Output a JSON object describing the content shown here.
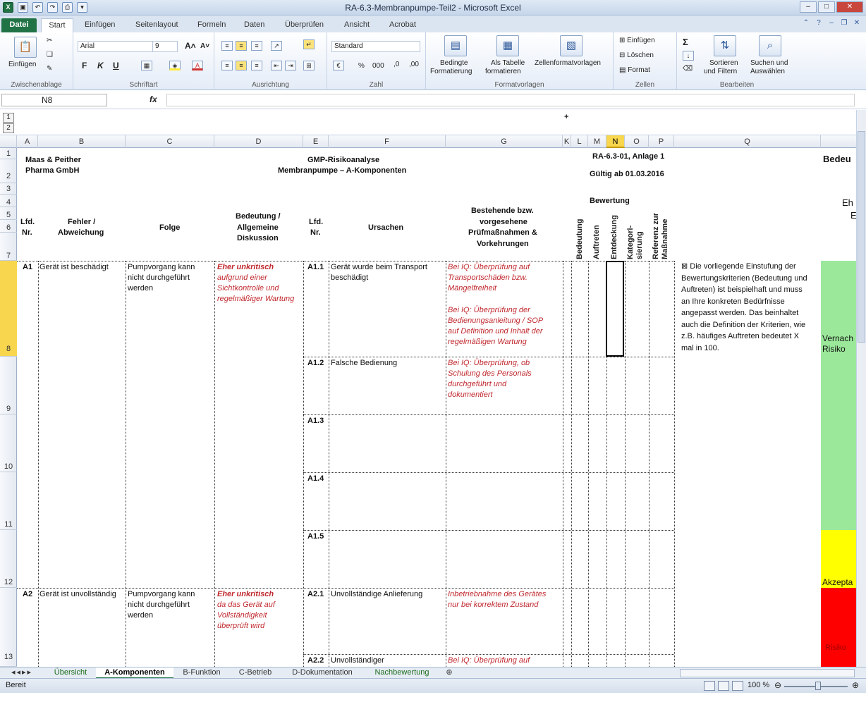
{
  "window": {
    "title": "RA-6.3-Membranpumpe-Teil2 - Microsoft Excel",
    "app_icon": "excel-icon"
  },
  "ribbon_tabs": [
    "Datei",
    "Start",
    "Einfügen",
    "Seitenlayout",
    "Formeln",
    "Daten",
    "Überprüfen",
    "Ansicht",
    "Acrobat"
  ],
  "ribbon": {
    "clipboard": {
      "label": "Zwischenablage",
      "paste": "Einfügen"
    },
    "font": {
      "label": "Schriftart",
      "name": "Arial",
      "size": "9",
      "bold": "F",
      "italic": "K",
      "underline": "U"
    },
    "alignment": {
      "label": "Ausrichtung"
    },
    "number": {
      "label": "Zahl",
      "format": "Standard",
      "percent": "%",
      "thousands": "000"
    },
    "styles": {
      "label": "Formatvorlagen",
      "conditional": "Bedingte",
      "conditional2": "Formatierung",
      "table": "Als Tabelle",
      "table2": "formatieren",
      "cell": "Zellenformatvorlagen"
    },
    "cells": {
      "label": "Zellen",
      "insert": "Einfügen",
      "delete": "Löschen",
      "format": "Format"
    },
    "editing": {
      "label": "Bearbeiten",
      "sort": "Sortieren",
      "sort2": "und Filtern",
      "find": "Suchen und",
      "find2": "Auswählen"
    }
  },
  "formula_bar": {
    "name_box": "N8",
    "fx": "fx",
    "content": ""
  },
  "outline_levels": [
    "1",
    "2"
  ],
  "columns": [
    "A",
    "B",
    "C",
    "D",
    "E",
    "F",
    "G",
    "K",
    "L",
    "M",
    "N",
    "O",
    "P",
    "Q"
  ],
  "selected_column": "N",
  "rows": [
    "1",
    "2",
    "3",
    "4",
    "5",
    "6",
    "7",
    "8",
    "9",
    "10",
    "11",
    "12",
    "13"
  ],
  "selected_row": "8",
  "header": {
    "company1": "Maas & Peither",
    "company2": "Pharma GmbH",
    "title1": "GMP-Risikoanalyse",
    "title2": "Membranpumpe – A-Komponenten",
    "doc_ref": "RA-6.3-01, Anlage 1",
    "valid": "Gültig ab 01.03.2016",
    "right_head": "Bedeu",
    "right_eh": "Eh",
    "right_e": "E"
  },
  "table_headers": {
    "lfd1a": "Lfd.",
    "lfd1b": "Nr.",
    "fehler1": "Fehler /",
    "fehler2": "Abweichung",
    "folge": "Folge",
    "bedeutung1": "Bedeutung /",
    "bedeutung2": "Allgemeine",
    "bedeutung3": "Diskussion",
    "lfd2a": "Lfd.",
    "lfd2b": "Nr.",
    "ursachen": "Ursachen",
    "massn1": "Bestehende bzw.",
    "massn2": "vorgesehene",
    "massn3": "Prüfmaßnahmen &",
    "massn4": "Vorkehrungen",
    "bewertung": "Bewertung",
    "v_bedeutung": "Bedeutung",
    "v_auftreten": "Auftreten",
    "v_entdeckung": "Entdeckung",
    "v_kategori1": "Kategori-",
    "v_kategori2": "sierung",
    "v_referenz1": "Referenz zur",
    "v_referenz2": "Maßnahme"
  },
  "rows_data": {
    "r8": {
      "id": "A1",
      "fehler": "Gerät ist beschädigt",
      "folge": [
        "Pumpvorgang kann",
        "nicht durchgeführt",
        "werden"
      ],
      "bed_bold": "Eher unkritisch",
      "bed": [
        "aufgrund einer",
        "Sichtkontrolle und",
        "regelmäßiger Wartung"
      ],
      "sub": "A1.1",
      "ursache": [
        "Gerät wurde beim Transport",
        "beschädigt"
      ],
      "massn": [
        "Bei IQ: Überprüfung auf",
        "Transportschäden bzw.",
        "Mängelfreiheit",
        "",
        "Bei IQ: Überprüfung der",
        "Bedienungsanleitung / SOP",
        "auf Definition und Inhalt der",
        "regelmäßigen Wartung"
      ]
    },
    "r9": {
      "sub": "A1.2",
      "ursache": "Falsche Bedienung",
      "massn": [
        "Bei IQ: Überprüfung, ob",
        "Schulung des Personals",
        "durchgeführt und",
        "dokumentiert"
      ]
    },
    "r10": {
      "sub": "A1.3"
    },
    "r11": {
      "sub": "A1.4"
    },
    "r12": {
      "sub": "A1.5"
    },
    "r13": {
      "id": "A2",
      "fehler": "Gerät ist unvollständig",
      "folge": [
        "Pumpvorgang kann",
        "nicht durchgeführt",
        "werden"
      ],
      "bed_bold": "Eher unkritisch",
      "bed": [
        "da das Gerät auf",
        "Vollständigkeit",
        "überprüft wird"
      ],
      "sub": "A2.1",
      "ursache": "Unvollständige Anlieferung",
      "massn": [
        "Inbetriebnahme des Gerätes",
        "nur bei korrektem Zustand"
      ]
    },
    "r14": {
      "sub": "A2.2",
      "ursache": "Unvollständiger",
      "massn": "Bei IQ: Überprüfung auf"
    }
  },
  "note": [
    "⊠ Die vorliegende Einstufung der",
    "Bewertungskriterien (Bedeutung und",
    "Auftreten) ist beispielhaft und muss",
    "an Ihre konkreten Bedürfnisse",
    "angepasst werden. Das beinhaltet",
    "auch die Definition der Kriterien, wie",
    "z.B. häufiges Auftreten bedeutet X",
    "mal in 100."
  ],
  "legend": {
    "green_label1": "Vernach",
    "green_label2": "Risiko",
    "yellow_label": "Akzepta",
    "red_label": "Risiko",
    "colors": {
      "green": "#9be89b",
      "yellow": "#ffff00",
      "red": "#ff0000"
    }
  },
  "sheet_tabs": [
    "Übersicht",
    "A-Komponenten",
    "B-Funktion",
    "C-Betrieb",
    "D-Dokumentation",
    "Nachbewertung"
  ],
  "active_sheet": "A-Komponenten",
  "status": {
    "ready": "Bereit",
    "zoom": "100 %"
  }
}
